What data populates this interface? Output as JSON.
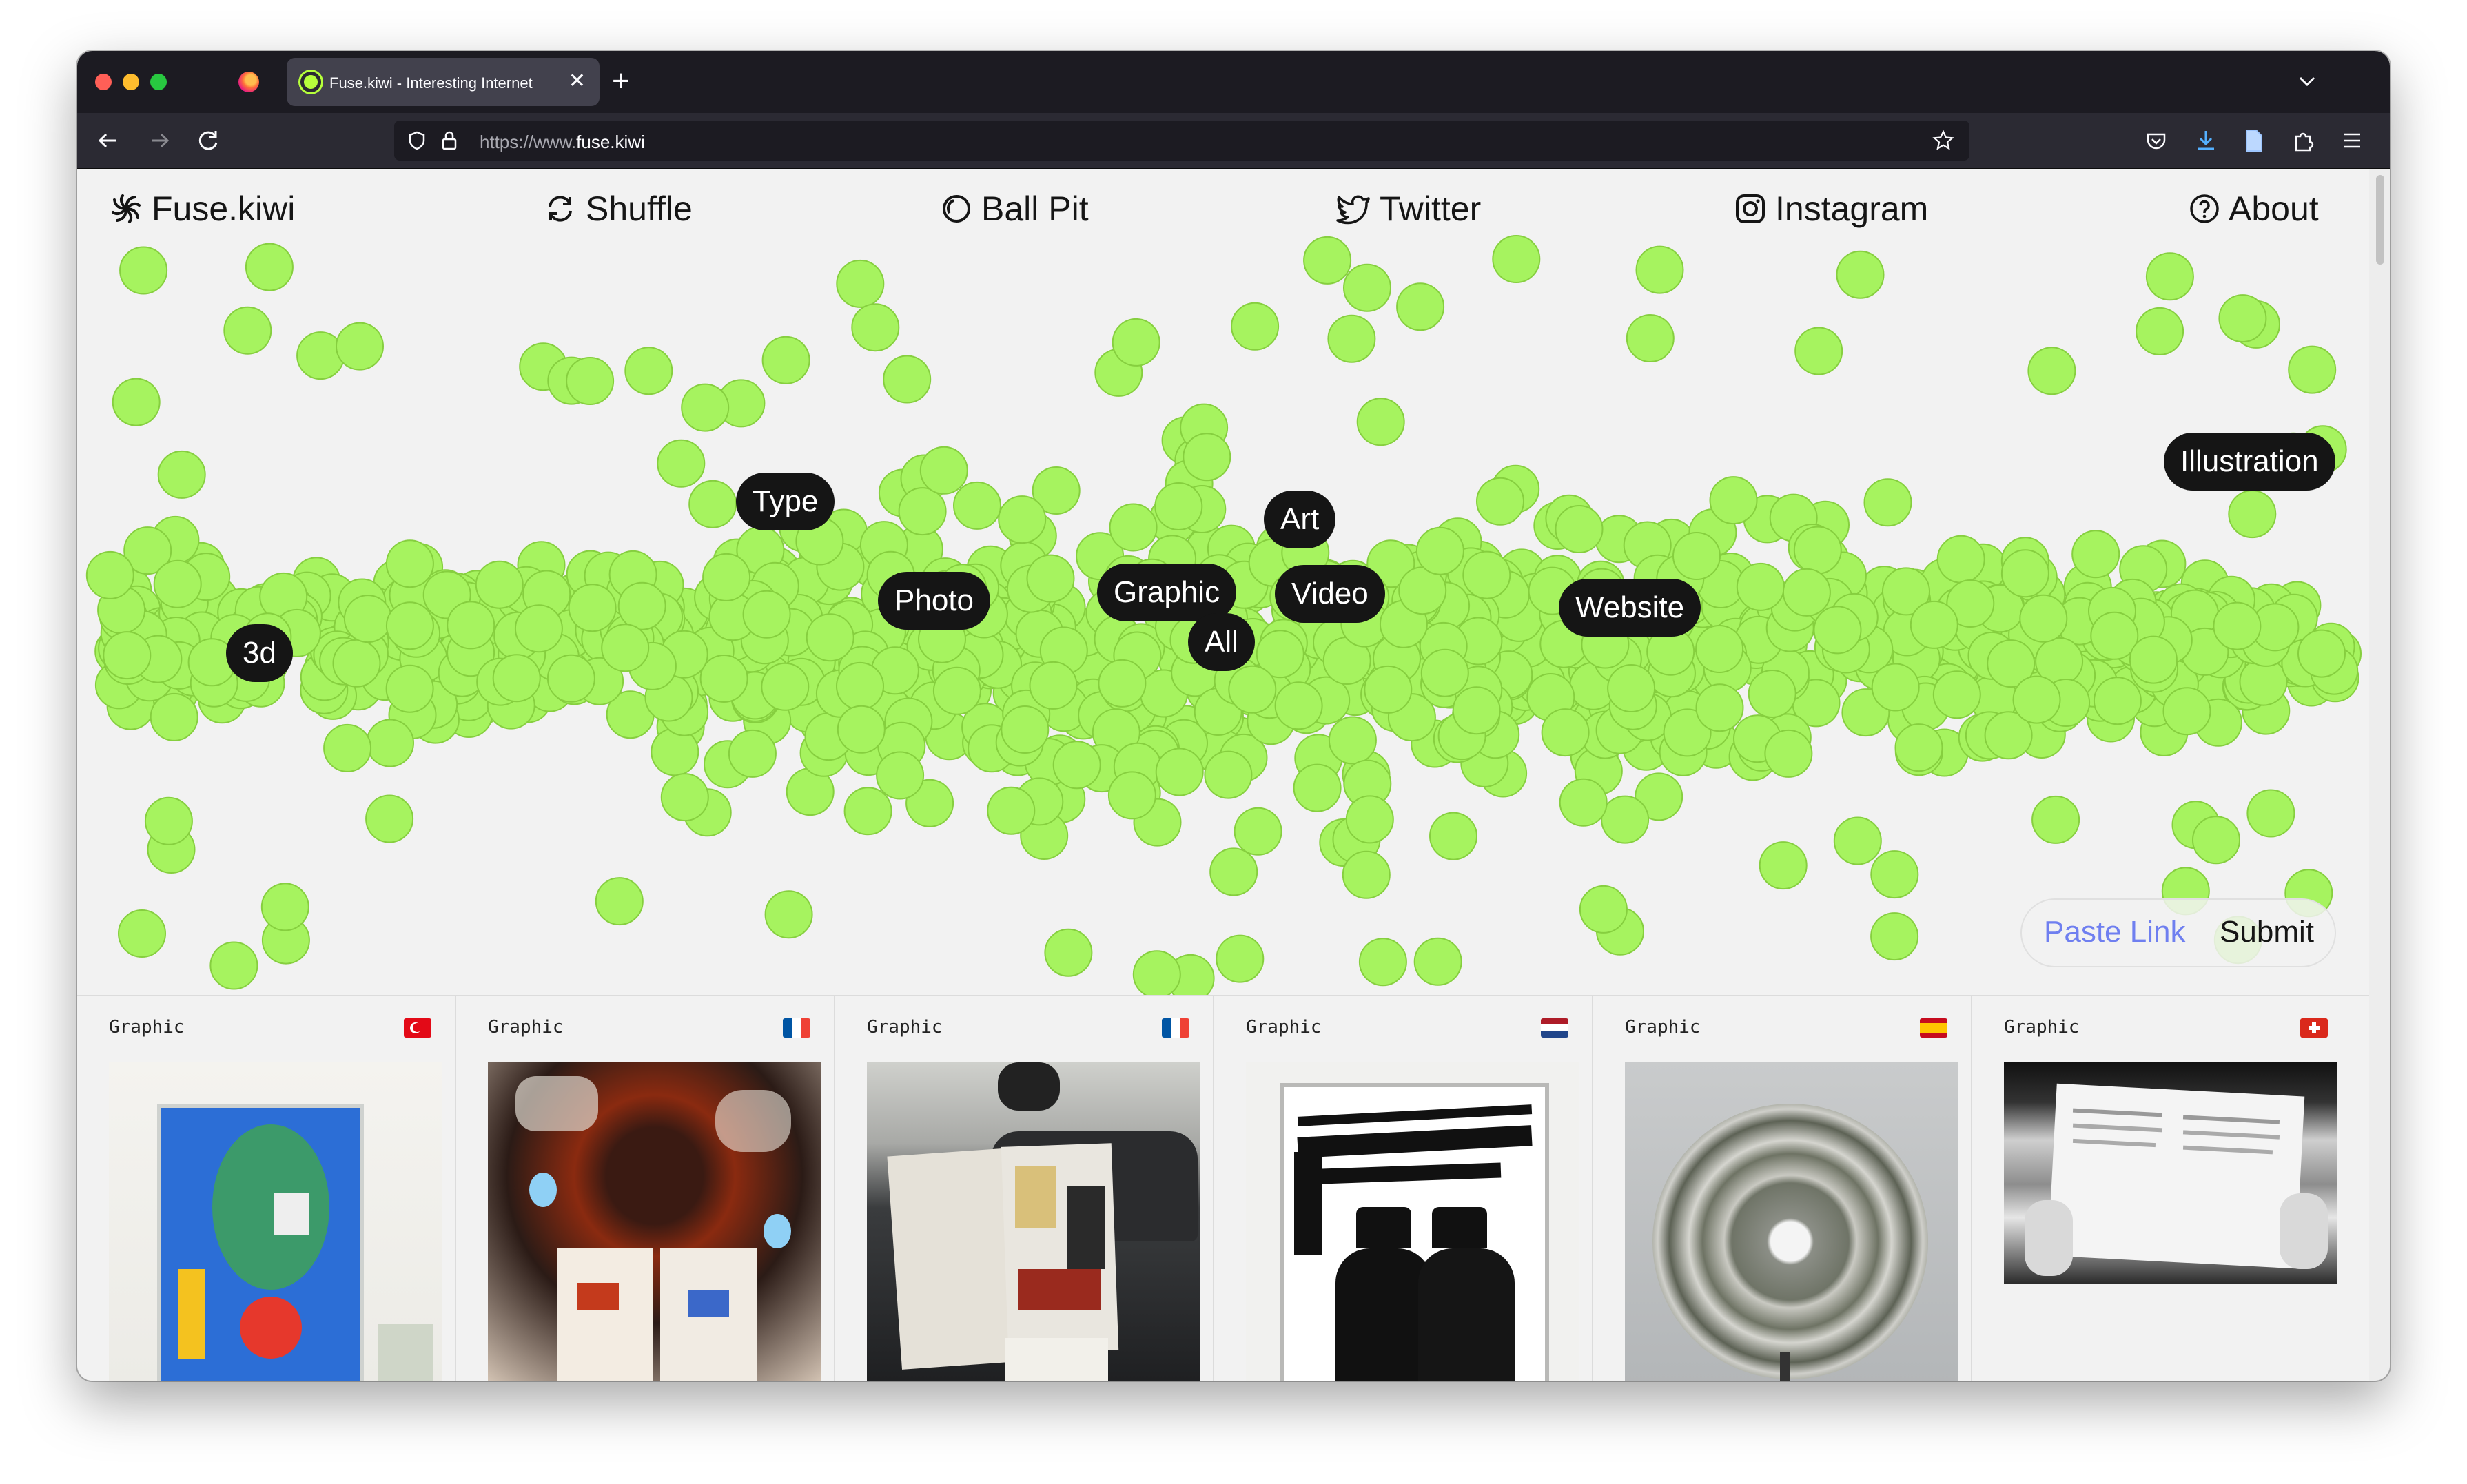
{
  "browser": {
    "tab_title": "Fuse.kiwi - Interesting Internet",
    "url_prefix": "https://www.",
    "url_host": "fuse.kiwi",
    "traffic_lights": [
      "#ff5f57",
      "#febc2e",
      "#28c840"
    ]
  },
  "site": {
    "logo": "Fuse.kiwi",
    "nav": {
      "shuffle": "Shuffle",
      "ball_pit": "Ball Pit",
      "twitter": "Twitter",
      "instagram": "Instagram",
      "about": "About"
    },
    "ball_color": "#a6f35f",
    "tags": {
      "type": "Type",
      "illustration": "Illustration",
      "art": "Art",
      "photo": "Photo",
      "graphic": "Graphic",
      "video": "Video",
      "website": "Website",
      "all": "All",
      "three_d": "3d"
    },
    "submit": {
      "placeholder": "Paste Link",
      "button": "Submit"
    }
  },
  "cards": [
    {
      "category": "Graphic",
      "flag": "turkey",
      "image": "blue and green painting in white room"
    },
    {
      "category": "Graphic",
      "flag": "france",
      "image": "orange and black collage with open book"
    },
    {
      "category": "Graphic",
      "flag": "france",
      "image": "magazine held on a motorbike seat"
    },
    {
      "category": "Graphic",
      "flag": "netherlands",
      "image": "framed black and white typographic poster"
    },
    {
      "category": "Graphic",
      "flag": "spain",
      "image": "circular spiky sculpture on grey wall"
    },
    {
      "category": "Graphic",
      "flag": "switzerland",
      "image": "hands holding printed leaflet"
    }
  ]
}
